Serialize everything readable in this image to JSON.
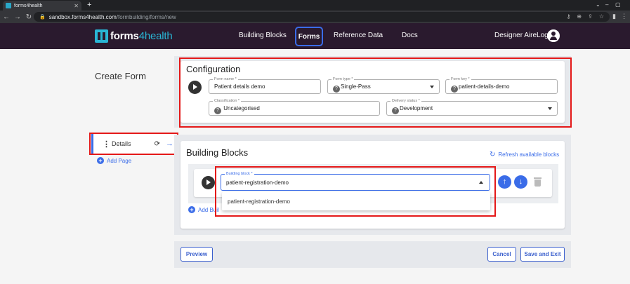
{
  "browser": {
    "tab_title": "forms4health",
    "url_host": "sandbox.forms4health.com",
    "url_path": "/formbuilding/forms/new"
  },
  "header": {
    "logo_main": "forms",
    "logo_accent": "4health",
    "nav": [
      "Building Blocks",
      "Forms",
      "Reference Data",
      "Docs"
    ],
    "active_nav": "Forms",
    "user": "Designer AireLogic"
  },
  "page": {
    "title": "Create Form"
  },
  "sidebar": {
    "items": [
      {
        "label": "Details"
      }
    ],
    "add_page": "Add Page"
  },
  "configuration": {
    "title": "Configuration",
    "form_name": {
      "label": "Form name *",
      "value": "Patient details demo"
    },
    "form_type": {
      "label": "Form type *",
      "value": "Single-Pass"
    },
    "form_key": {
      "label": "Form key *",
      "value": "patient-details-demo"
    },
    "classification": {
      "label": "Classification *",
      "value": "Uncategorised"
    },
    "delivery_status": {
      "label": "Delivery status *",
      "value": "Development"
    }
  },
  "building_blocks": {
    "title": "Building Blocks",
    "refresh": "Refresh available blocks",
    "field_label": "Building block *",
    "field_value": "patient-registration-demo",
    "options": [
      "patient-registration-demo"
    ],
    "add_label": "Add Buil"
  },
  "footer": {
    "preview": "Preview",
    "cancel": "Cancel",
    "save_exit": "Save and Exit"
  },
  "colors": {
    "header_bg": "#2a1a2e",
    "accent": "#3a6ce8",
    "brand": "#29b6d5",
    "highlight": "#e41818"
  }
}
